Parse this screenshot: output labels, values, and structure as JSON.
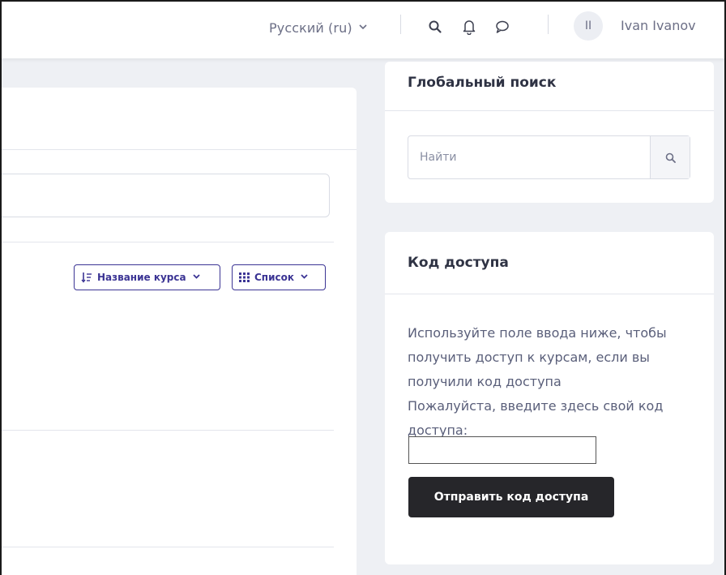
{
  "navbar": {
    "language": "Русский (ru)",
    "user": {
      "initials": "II",
      "name": "Ivan Ivanov"
    },
    "icons": [
      "search-icon",
      "bell-icon",
      "chat-icon",
      "chevron-down-icon"
    ]
  },
  "main": {
    "sort_button_label": "Название курса",
    "view_button_label": "Список"
  },
  "global_search": {
    "title": "Глобальный поиск",
    "placeholder": "Найти"
  },
  "access_code": {
    "title": "Код доступа",
    "description": "Используйте поле ввода ниже, чтобы получить доступ к курсам, если вы получили код доступа",
    "prompt": "Пожалуйста, введите здесь свой код доступа:",
    "input_value": "",
    "submit_label": "Отправить код доступа"
  },
  "colors": {
    "accent": "#3b3494",
    "page_bg": "#eef0f4",
    "button_dark": "#26262a",
    "muted_text": "#6c6f86"
  }
}
